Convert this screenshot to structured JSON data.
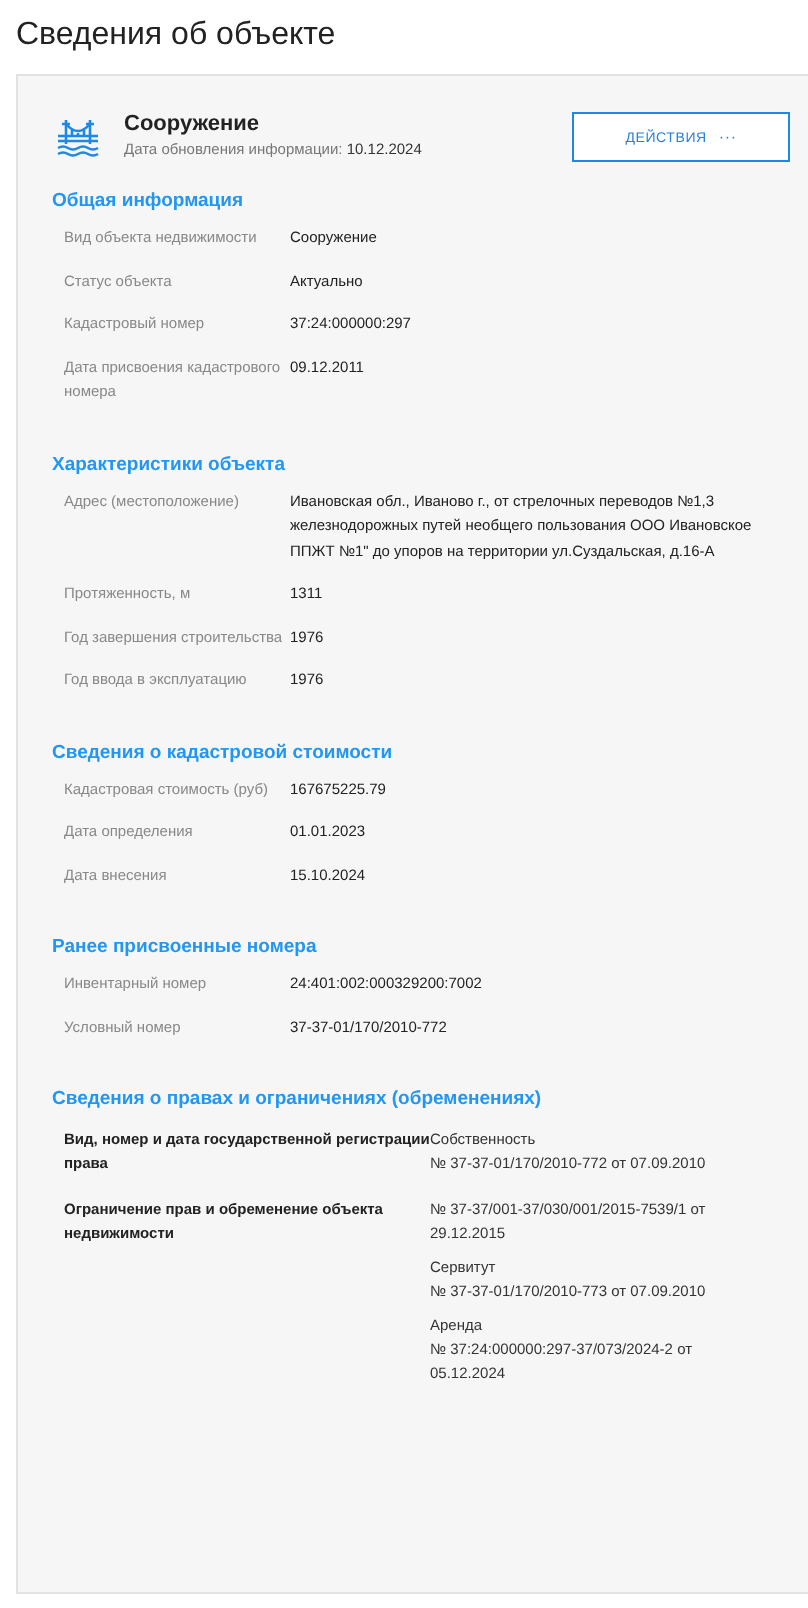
{
  "page_title": "Сведения об объекте",
  "object": {
    "type": "Сооружение",
    "updated_label": "Дата обновления информации:",
    "updated": "10.12.2024"
  },
  "actions_button": {
    "label": "ДЕЙСТВИЯ",
    "menu": "···"
  },
  "sections": [
    {
      "title": "Общая информация",
      "rows": [
        {
          "label": "Вид объекта недвижимости",
          "value": "Сооружение"
        },
        {
          "label": "Статус объекта",
          "value": "Актуально"
        },
        {
          "label": "Кадастровый номер",
          "value": "37:24:000000:297"
        },
        {
          "label": "Дата присвоения кадастрового номера",
          "value": "09.12.2011"
        }
      ]
    },
    {
      "title": "Характеристики объекта",
      "rows": [
        {
          "label": "Адрес (местоположение)",
          "value": "Ивановская обл., Иваново г., от стрелочных переводов №1,3 железнодорожных путей необщего пользования ООО Ивановское ППЖТ №1\" до упоров на территории ул.Суздальская, д.16-А"
        },
        {
          "label": "Протяженность, м",
          "value": "1311"
        },
        {
          "label": "Год завершения строительства",
          "value": "1976"
        },
        {
          "label": "Год ввода в эксплуатацию",
          "value": "1976"
        }
      ]
    },
    {
      "title": "Сведения о кадастровой стоимости",
      "rows": [
        {
          "label": "Кадастровая стоимость (руб)",
          "value": "167675225.79"
        },
        {
          "label": "Дата определения",
          "value": "01.01.2023"
        },
        {
          "label": "Дата внесения",
          "value": "15.10.2024"
        }
      ]
    },
    {
      "title": "Ранее присвоенные номера",
      "rows": [
        {
          "label": "Инвентарный номер",
          "value": "24:401:002:000329200:7002"
        },
        {
          "label": "Условный номер",
          "value": "37-37-01/170/2010-772"
        }
      ]
    }
  ],
  "rights": {
    "title": "Сведения о правах и ограничениях (обременениях)",
    "rows": [
      {
        "label": "Вид, номер и дата государственной регистрации права",
        "entries": [
          {
            "lines": [
              "Собственность",
              "№ 37-37-01/170/2010-772 от 07.09.2010"
            ]
          }
        ]
      },
      {
        "label": "Ограничение прав и обременение объекта недвижимости",
        "entries": [
          {
            "lines": [
              "№ 37-37/001-37/030/001/2015-7539/1 от 29.12.2015"
            ]
          },
          {
            "lines": [
              "Сервитут",
              "№ 37-37-01/170/2010-773 от 07.09.2010"
            ]
          },
          {
            "lines": [
              "Аренда",
              "№ 37:24:000000:297-37/073/2024-2 от 05.12.2024"
            ]
          }
        ]
      }
    ]
  }
}
